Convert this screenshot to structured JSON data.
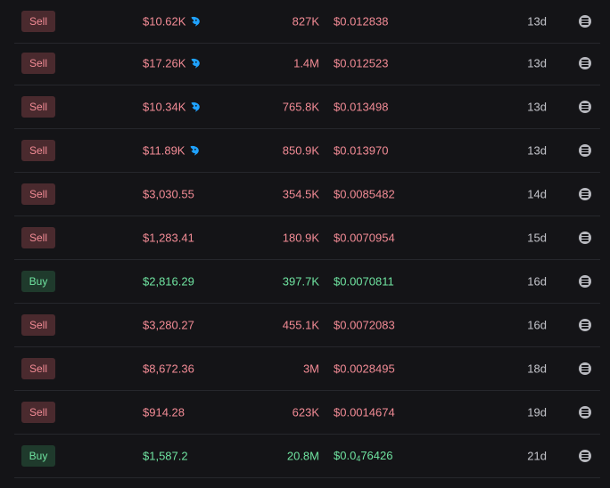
{
  "colors": {
    "sell_text": "#f28b95",
    "sell_bg": "#4a2a2e",
    "buy_text": "#6fe3a0",
    "buy_bg": "#1f3a2c",
    "whale_icon": "#1fa2ff"
  },
  "icons": {
    "whale": "whale-icon",
    "detail": "details-icon"
  },
  "trades": [
    {
      "type": "Sell",
      "usd": "$10.62K",
      "whale": true,
      "amount": "827K",
      "price": "$0.012838",
      "age": "13d"
    },
    {
      "type": "Sell",
      "usd": "$17.26K",
      "whale": true,
      "amount": "1.4M",
      "price": "$0.012523",
      "age": "13d"
    },
    {
      "type": "Sell",
      "usd": "$10.34K",
      "whale": true,
      "amount": "765.8K",
      "price": "$0.013498",
      "age": "13d"
    },
    {
      "type": "Sell",
      "usd": "$11.89K",
      "whale": true,
      "amount": "850.9K",
      "price": "$0.013970",
      "age": "13d"
    },
    {
      "type": "Sell",
      "usd": "$3,030.55",
      "whale": false,
      "amount": "354.5K",
      "price": "$0.0085482",
      "age": "14d"
    },
    {
      "type": "Sell",
      "usd": "$1,283.41",
      "whale": false,
      "amount": "180.9K",
      "price": "$0.0070954",
      "age": "15d"
    },
    {
      "type": "Buy",
      "usd": "$2,816.29",
      "whale": false,
      "amount": "397.7K",
      "price": "$0.0070811",
      "age": "16d"
    },
    {
      "type": "Sell",
      "usd": "$3,280.27",
      "whale": false,
      "amount": "455.1K",
      "price": "$0.0072083",
      "age": "16d"
    },
    {
      "type": "Sell",
      "usd": "$8,672.36",
      "whale": false,
      "amount": "3M",
      "price": "$0.0028495",
      "age": "18d"
    },
    {
      "type": "Sell",
      "usd": "$914.28",
      "whale": false,
      "amount": "623K",
      "price": "$0.0014674",
      "age": "19d"
    },
    {
      "type": "Buy",
      "usd": "$1,587.2",
      "whale": false,
      "amount": "20.8M",
      "price_prefix": "$0.0",
      "price_sub": "4",
      "price_suffix": "76426",
      "age": "21d"
    }
  ]
}
